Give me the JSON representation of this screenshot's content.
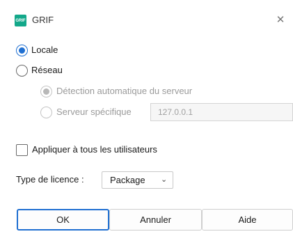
{
  "window": {
    "title": "GRIF",
    "app_icon_text": "GRIF",
    "close_glyph": "✕"
  },
  "mode": {
    "local_label": "Locale",
    "network_label": "Réseau",
    "auto_detect_label": "Détection automatique du serveur",
    "specific_server_label": "Serveur spécifique",
    "server_address_value": "127.0.0.1",
    "selected": "Locale"
  },
  "options": {
    "apply_all_users_label": "Appliquer à tous les utilisateurs",
    "apply_all_users_checked": false
  },
  "license": {
    "label": "Type de licence :",
    "selected_value": "Package",
    "chevron_glyph": "⌄"
  },
  "buttons": {
    "ok": "OK",
    "cancel": "Annuler",
    "help": "Aide"
  },
  "colors": {
    "accent": "#1f6fd1",
    "app_icon": "#13a88a"
  }
}
